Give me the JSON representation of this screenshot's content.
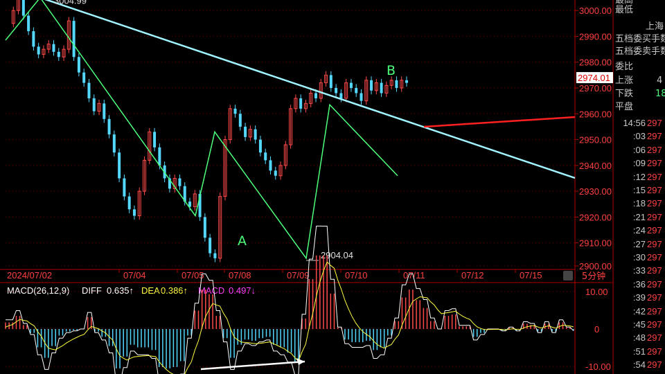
{
  "chart_data": {
    "type": "candlestick",
    "instrument": "上海",
    "period_label": "5分钟",
    "x_ticks": [
      "2024/07/02",
      "07/04",
      "07/05",
      "07/08",
      "07/09",
      "07/10",
      "07/11",
      "07/12",
      "07/15"
    ],
    "y_ticks": [
      "3000.00",
      "2990.00",
      "2980.00",
      "2970.00",
      "2960.00",
      "2950.00",
      "2940.00",
      "2930.00",
      "2920.00",
      "2910.00",
      "2900.00"
    ],
    "ylim": [
      2900,
      3003
    ],
    "current_price": "2974.01",
    "annotations": {
      "high": "3004.99",
      "low": "2904.04",
      "wave_a": "A",
      "wave_b": "B"
    },
    "zigzag": [
      3004.99,
      2920.5,
      2953.0,
      2904.04,
      2963.5,
      2936.0
    ],
    "close_series": [
      2995,
      3000,
      3004.99,
      2998,
      2992,
      2986,
      2983,
      2985,
      2987,
      2984,
      2982,
      2985,
      2996,
      2982,
      2976,
      2972,
      2966,
      2961,
      2964,
      2958,
      2952,
      2945,
      2935,
      2928,
      2923,
      2920.5,
      2930,
      2942,
      2953,
      2947,
      2940,
      2935,
      2931,
      2935,
      2932,
      2926,
      2924,
      2929,
      2920,
      2912,
      2906,
      2904.04,
      2928,
      2950,
      2962,
      2960,
      2955,
      2951,
      2954,
      2950,
      2945,
      2942,
      2938,
      2936,
      2940,
      2948,
      2962,
      2966,
      2962,
      2964,
      2968,
      2966,
      2972,
      2975,
      2970,
      2968,
      2966,
      2972,
      2970,
      2968,
      2965,
      2973,
      2969,
      2972,
      2968,
      2971,
      2973,
      2970,
      2973,
      2972
    ],
    "macd": {
      "label": "MACD(26,12,9)",
      "diff_label": "DIFF",
      "diff_value": "0.635↑",
      "dea_label": "DEA",
      "dea_value": "0.386↑",
      "macd_label": "MACD",
      "macd_value": "0.497↓",
      "y_ticks": [
        "10.00",
        "0",
        "-10.00"
      ],
      "ylim": [
        -10,
        10
      ]
    }
  },
  "side_panel": {
    "top_labels": [
      "最高",
      "最低"
    ],
    "market": "上海",
    "rows": [
      "五档委买手数",
      "五档委卖手数",
      "委比",
      "上涨",
      "下跌",
      "平盘"
    ],
    "up_value": "4",
    "down_value": "18",
    "ticks": [
      {
        "time": "14:56",
        "price": "297"
      },
      {
        "time": ":03",
        "price": "297"
      },
      {
        "time": ":06",
        "price": "297"
      },
      {
        "time": ":09",
        "price": "297"
      },
      {
        "time": ":12",
        "price": "297"
      },
      {
        "time": ":15",
        "price": "297"
      },
      {
        "time": ":18",
        "price": "297"
      },
      {
        "time": ":21",
        "price": "297"
      },
      {
        "time": ":24",
        "price": "297"
      },
      {
        "time": ":27",
        "price": "297"
      },
      {
        "time": ":30",
        "price": "297"
      },
      {
        "time": ":33",
        "price": "297"
      },
      {
        "time": ":36",
        "price": "297"
      },
      {
        "time": ":39",
        "price": "297"
      },
      {
        "time": ":42",
        "price": "297"
      },
      {
        "time": ":45",
        "price": "297"
      },
      {
        "time": ":48",
        "price": "297"
      },
      {
        "time": ":51",
        "price": "297"
      },
      {
        "time": ":54",
        "price": "297"
      }
    ]
  },
  "colors": {
    "up": "#ff4a4a",
    "down": "#54d8ff",
    "grid": "#7a0000",
    "trend": "#9ff4ff",
    "zigzag": "#4cff7a",
    "support": "#ff2020",
    "diff": "#ffffff",
    "dea": "#ffff40",
    "macd": "#ff40ff"
  }
}
